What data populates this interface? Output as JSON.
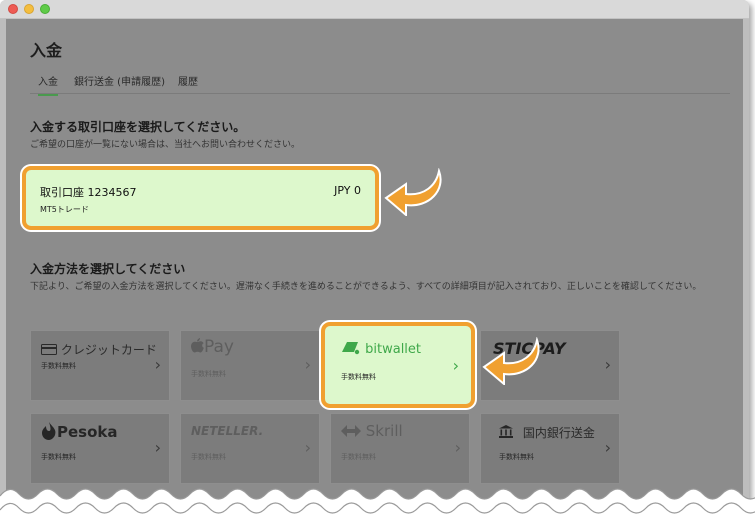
{
  "page": {
    "title": "入金",
    "tabs": [
      {
        "label": "入金",
        "active": true
      },
      {
        "label": "銀行送金 (申請履歴)",
        "active": false
      },
      {
        "label": "履歴",
        "active": false
      }
    ]
  },
  "account_section": {
    "heading": "入金する取引口座を選択してください。",
    "subtext": "ご希望の口座が一覧にない場合は、当社へお問い合わせください。",
    "account": {
      "name": "取引口座 1234567",
      "balance": "JPY 0",
      "type": "MT5トレード"
    }
  },
  "method_section": {
    "heading": "入金方法を選択してください",
    "subtext": "下記より、ご希望の入金方法を選択してください。遅滞なく手続きを進めることができるよう、すべての詳細項目が記入されており、正しいことを確認してください。"
  },
  "methods": [
    {
      "name": "クレジットカード",
      "fee": "手数料無料"
    },
    {
      "name": "Pay",
      "fee": "手数料無料"
    },
    {
      "name": "bitwallet",
      "fee": "手数料無料"
    },
    {
      "name": "STICPAY",
      "fee": ""
    },
    {
      "name": "Pesoka",
      "fee": "手数料無料"
    },
    {
      "name": "NETELLER.",
      "fee": "手数料無料"
    },
    {
      "name": "Skrill",
      "fee": "手数料無料"
    },
    {
      "name": "国内銀行送金",
      "fee": "手数料無料"
    }
  ],
  "colors": {
    "highlight_border": "#f0a030",
    "card_fill": "#ddf8cc",
    "tab_underline": "#4a9a4e",
    "bitwallet_green": "#3fa84a"
  }
}
